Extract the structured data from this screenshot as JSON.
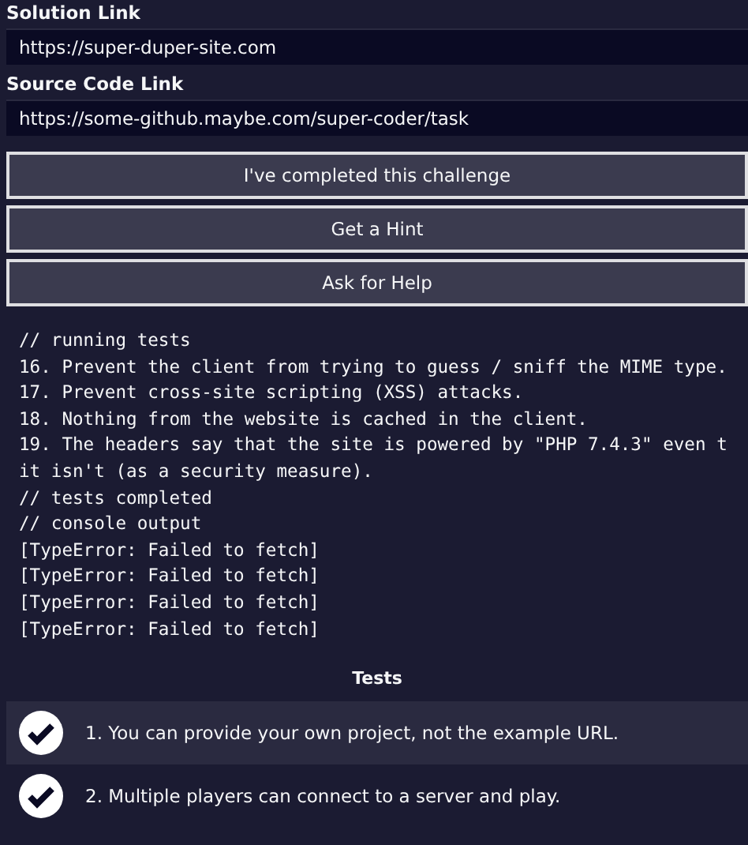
{
  "fields": [
    {
      "label": "Solution Link",
      "value": "https://super-duper-site.com"
    },
    {
      "label": "Source Code Link",
      "value": "https://some-github.maybe.com/super-coder/task"
    }
  ],
  "buttons": [
    "I've completed this challenge",
    "Get a Hint",
    "Ask for Help"
  ],
  "console_lines": [
    "// running tests",
    "16. Prevent the client from trying to guess / sniff the MIME type.",
    "17. Prevent cross-site scripting (XSS) attacks.",
    "18. Nothing from the website is cached in the client.",
    "19. The headers say that the site is powered by \"PHP 7.4.3\" even t",
    "it isn't (as a security measure).",
    "// tests completed",
    "// console output",
    "[TypeError: Failed to fetch]",
    "[TypeError: Failed to fetch]",
    "[TypeError: Failed to fetch]",
    "[TypeError: Failed to fetch]"
  ],
  "tests": {
    "title": "Tests",
    "items": [
      {
        "text": "1. You can provide your own project, not the example URL.",
        "passed": true
      },
      {
        "text": "2. Multiple players can connect to a server and play.",
        "passed": true
      }
    ]
  }
}
